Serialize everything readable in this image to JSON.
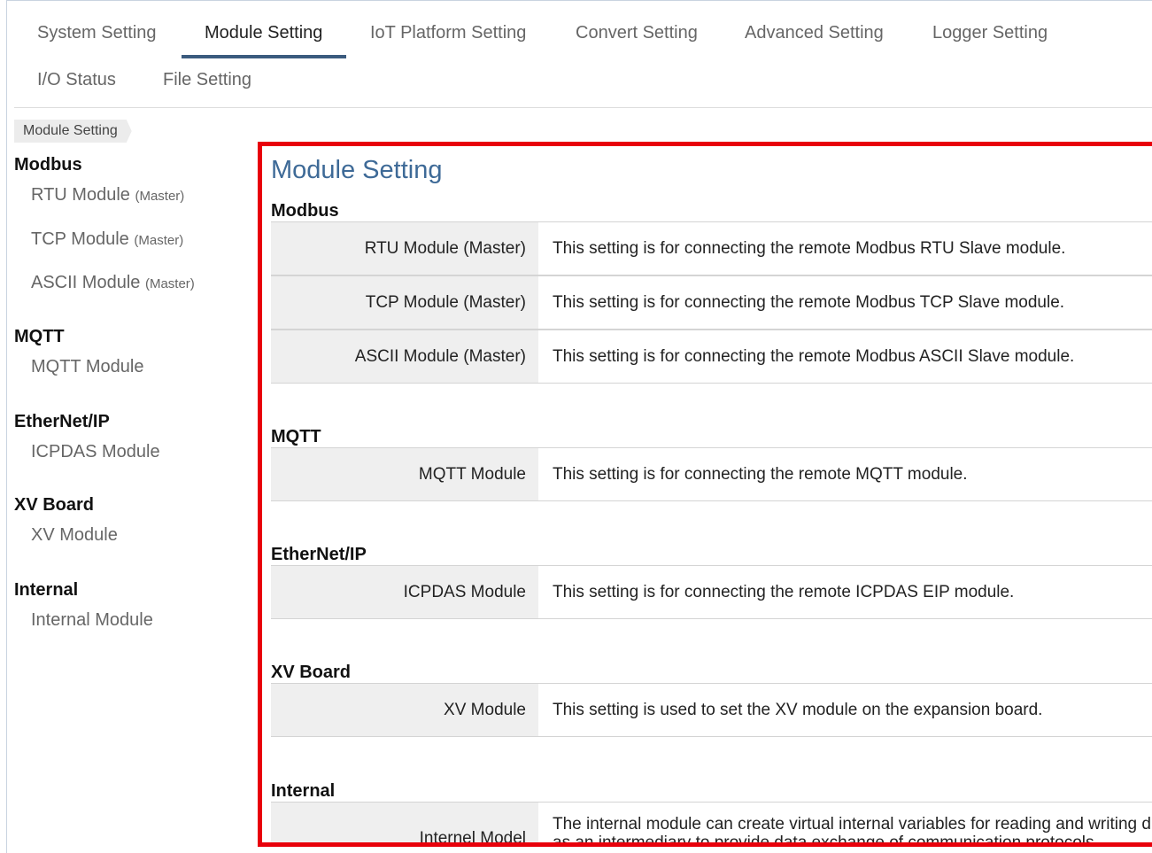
{
  "nav": {
    "tabs": [
      {
        "label": "System Setting"
      },
      {
        "label": "Module Setting"
      },
      {
        "label": "IoT Platform Setting"
      },
      {
        "label": "Convert Setting"
      },
      {
        "label": "Advanced Setting"
      },
      {
        "label": "Logger Setting"
      },
      {
        "label": "I/O Status"
      },
      {
        "label": "File Setting"
      }
    ],
    "active_tab": "Module Setting"
  },
  "breadcrumb": "Module Setting",
  "sidebar": {
    "groups": [
      {
        "title": "Modbus",
        "items": [
          {
            "label": "RTU Module",
            "sub": "(Master)"
          },
          {
            "label": "TCP Module",
            "sub": "(Master)"
          },
          {
            "label": "ASCII Module",
            "sub": "(Master)"
          }
        ]
      },
      {
        "title": "MQTT",
        "items": [
          {
            "label": "MQTT Module"
          }
        ]
      },
      {
        "title": "EtherNet/IP",
        "items": [
          {
            "label": "ICPDAS Module"
          }
        ]
      },
      {
        "title": "XV Board",
        "items": [
          {
            "label": "XV Module"
          }
        ]
      },
      {
        "title": "Internal",
        "items": [
          {
            "label": "Internal Module"
          }
        ]
      }
    ]
  },
  "main": {
    "title": "Module Setting",
    "sections": [
      {
        "heading": "Modbus",
        "rows": [
          {
            "label": "RTU Module (Master)",
            "desc": "This setting is for connecting the remote Modbus RTU Slave module."
          },
          {
            "label": "TCP Module (Master)",
            "desc": "This setting is for connecting the remote Modbus TCP Slave module."
          },
          {
            "label": "ASCII Module (Master)",
            "desc": "This setting is for connecting the remote Modbus ASCII Slave module."
          }
        ]
      },
      {
        "heading": "MQTT",
        "rows": [
          {
            "label": "MQTT Module",
            "desc": "This setting is for connecting the remote MQTT module."
          }
        ]
      },
      {
        "heading": "EtherNet/IP",
        "rows": [
          {
            "label": "ICPDAS Module",
            "desc": "This setting is for connecting the remote ICPDAS EIP module."
          }
        ]
      },
      {
        "heading": "XV Board",
        "rows": [
          {
            "label": "XV Module",
            "desc": "This setting is used to set the XV module on the expansion board."
          }
        ]
      },
      {
        "heading": "Internal",
        "rows": [
          {
            "label": "Internel Model",
            "desc": "The internal module can create virtual internal variables for reading and writing d",
            "desc2": "as an intermediary to provide data exchange of communication protocols."
          }
        ]
      }
    ]
  },
  "colors": {
    "highlight_border": "#e8000b",
    "title_blue": "#3e6a97",
    "tab_underline": "#3b5b7e",
    "label_bg": "#efefef"
  }
}
